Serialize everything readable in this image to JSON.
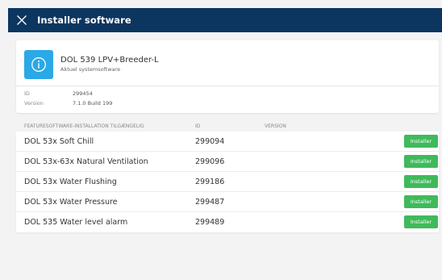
{
  "header": {
    "title": "Installer software",
    "close_icon": "close-icon",
    "bg_color": "#0c3660"
  },
  "system": {
    "icon": "info-icon",
    "icon_color": "#2ba8e6",
    "name": "DOL 539 LPV+Breeder-L",
    "subtitle": "Aktuel systemsoftware",
    "id_label": "ID",
    "id_value": "299454",
    "version_label": "Version",
    "version_value": "7.1.0 Build 199"
  },
  "table": {
    "columns": [
      "FEATURESOFTWARE-INSTALLATION TILGÆNGELIG",
      "ID",
      "VERSION"
    ],
    "install_label": "Installer",
    "button_color": "#3fba5b",
    "rows": [
      {
        "name": "DOL 53x Soft Chill",
        "id": "299094"
      },
      {
        "name": "DOL 53x-63x Natural Ventilation",
        "id": "299096"
      },
      {
        "name": "DOL 53x Water Flushing",
        "id": "299186"
      },
      {
        "name": "DOL 53x Water Pressure",
        "id": "299487"
      },
      {
        "name": "DOL 535 Water level alarm",
        "id": "299489"
      }
    ]
  }
}
